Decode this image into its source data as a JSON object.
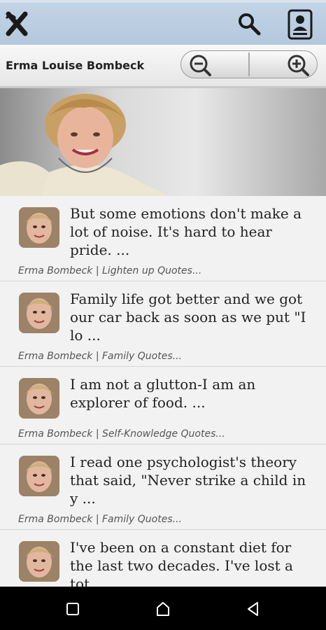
{
  "header": {
    "logo_icon": "x-logo-icon",
    "search_icon": "search-icon",
    "contact_icon": "contact-card-icon"
  },
  "subbar": {
    "title": "Erma Louise Bombeck",
    "zoom_out_icon": "zoom-out-icon",
    "zoom_in_icon": "zoom-in-icon"
  },
  "quotes": [
    {
      "text": "But some emotions don't make a lot of noise. It's hard to hear pride.  ...",
      "source": "Erma Bombeck | Lighten up Quotes..."
    },
    {
      "text": "Family life got better and we got our car back as soon as we put \"I lo ...",
      "source": "Erma Bombeck | Family Quotes..."
    },
    {
      "text": "I am not a glutton-I am an explorer of food. ...",
      "source": "Erma Bombeck | Self-Knowledge Quotes..."
    },
    {
      "text": "I read one psychologist's theory that said, \"Never strike a child in y ...",
      "source": "Erma Bombeck | Family Quotes..."
    },
    {
      "text": "I've been on a constant diet for the last two decades. I've lost a tot",
      "source": ""
    }
  ],
  "navbar": {
    "recent_icon": "square-recents-icon",
    "home_icon": "home-icon",
    "back_icon": "triangle-back-icon"
  }
}
